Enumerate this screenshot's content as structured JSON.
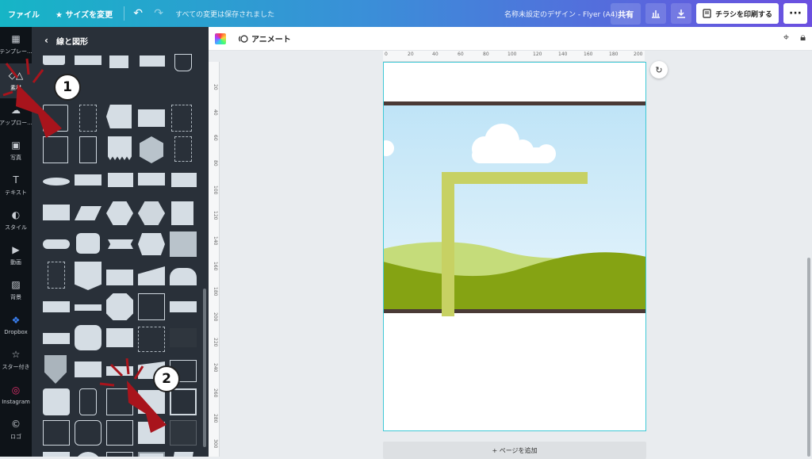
{
  "topbar": {
    "file_label": "ファイル",
    "resize_label": "★ サイズを変更",
    "undo_icon": "undo-icon",
    "redo_icon": "redo-icon",
    "saved_status": "すべての変更は保存されました",
    "design_title": "名称未設定のデザイン - Flyer (A4)",
    "share_label": "共有",
    "print_label": "チラシを印刷する",
    "more_label": "···"
  },
  "rail": {
    "items": [
      {
        "label": "テンプレー...",
        "icon": "▦"
      },
      {
        "label": "素材",
        "icon": "◇△"
      },
      {
        "label": "アップロー...",
        "icon": "☁"
      },
      {
        "label": "写真",
        "icon": "▣"
      },
      {
        "label": "テキスト",
        "icon": "T"
      },
      {
        "label": "スタイル",
        "icon": "◐"
      },
      {
        "label": "動画",
        "icon": "▶"
      },
      {
        "label": "背景",
        "icon": "▨"
      },
      {
        "label": "Dropbox",
        "icon": "❖"
      },
      {
        "label": "スター付き",
        "icon": "☆"
      },
      {
        "label": "Instagram",
        "icon": "◎"
      },
      {
        "label": "ロゴ",
        "icon": "©"
      }
    ]
  },
  "panel": {
    "title": "線と図形"
  },
  "canvas_toolbar": {
    "animate_label": "アニメート"
  },
  "ruler": {
    "top_ticks": [
      "0",
      "20",
      "40",
      "60",
      "80",
      "100",
      "120",
      "140",
      "160",
      "180",
      "200"
    ],
    "left_ticks": [
      "20",
      "40",
      "60",
      "80",
      "100",
      "120",
      "140",
      "160",
      "180",
      "200",
      "220",
      "240",
      "260",
      "280",
      "300"
    ]
  },
  "page": {
    "add_page_label": "+ ページを追加"
  },
  "callouts": [
    "1",
    "2"
  ],
  "colors": {
    "accent_start": "#16b5c6",
    "accent_end": "#6b4fe0",
    "page_border": "#3ec9d6",
    "sky": "#cfe9f8",
    "hill_light": "#c5dc7a",
    "hill_dark": "#85a313",
    "frame_line": "#c7d163",
    "band": "#4a3a36",
    "arrow_red": "#a8141c"
  }
}
